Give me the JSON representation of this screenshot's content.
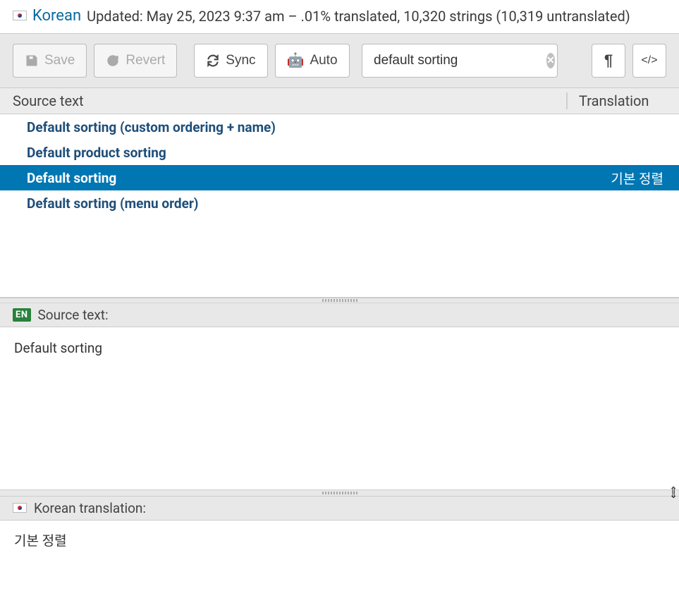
{
  "header": {
    "language": "Korean",
    "status": "Updated: May 25, 2023 9:37 am – .01% translated, 10,320 strings (10,319 untranslated)"
  },
  "toolbar": {
    "save": "Save",
    "revert": "Revert",
    "sync": "Sync",
    "auto": "Auto",
    "search_value": "default sorting"
  },
  "columns": {
    "source": "Source text",
    "translation": "Translation"
  },
  "rows": [
    {
      "source": "Default sorting (custom ordering + name)",
      "translation": "",
      "selected": false
    },
    {
      "source": "Default product sorting",
      "translation": "",
      "selected": false
    },
    {
      "source": "Default sorting",
      "translation": "기본 정렬",
      "selected": true
    },
    {
      "source": "Default sorting (menu order)",
      "translation": "",
      "selected": false
    }
  ],
  "source_panel": {
    "badge": "EN",
    "label": "Source text:",
    "value": "Default sorting"
  },
  "translation_panel": {
    "label": "Korean translation:",
    "value": "기본 정렬"
  }
}
